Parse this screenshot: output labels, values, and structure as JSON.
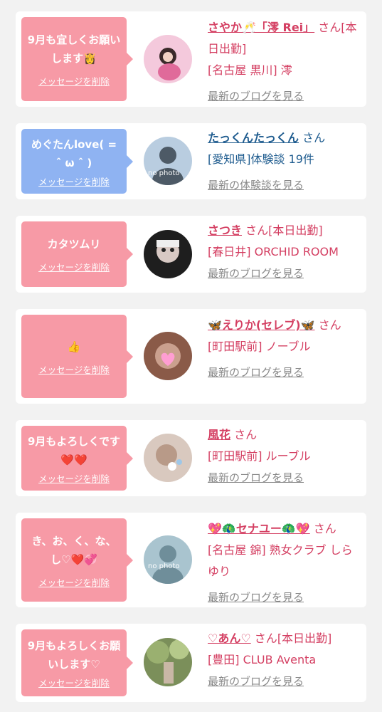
{
  "entries": [
    {
      "message": "9月も宜しくお願いします👸",
      "delete_label": "メッセージを削除",
      "name": "さやか🥂「澪 Rei」",
      "honorific": "さん",
      "detail1": "[本日出勤]",
      "detail2": "[名古屋 黒川] 澪",
      "blog_label": "最新のブログを見る",
      "bubble_color": "#f79aa6",
      "text_color": "#d43f62"
    },
    {
      "message": "めぐたんlove( = ˆ ω ˆ )",
      "delete_label": "メッセージを削除",
      "name": "たっくんたっくん",
      "honorific": "さん",
      "detail1": "[愛知県]体験談 19件",
      "detail2": "",
      "blog_label": "最新の体験談を見る",
      "avatar_text": "no photo",
      "bubble_color": "#8fb3f2",
      "text_color": "#1f5c8f"
    },
    {
      "message": "カタツムリ",
      "delete_label": "メッセージを削除",
      "name": "さつき",
      "honorific": "さん",
      "detail1": "[本日出勤]",
      "detail2": "[春日井] ORCHID ROOM",
      "blog_label": "最新のブログを見る"
    },
    {
      "message": "👍",
      "delete_label": "メッセージを削除",
      "name": "🦋えりか(セレブ)🦋",
      "honorific": "さん",
      "detail1": "",
      "detail2": "[町田駅前] ノーブル",
      "blog_label": "最新のブログを見る"
    },
    {
      "message": "9月もよろしくです❤️❤️",
      "delete_label": "メッセージを削除",
      "name": "風花",
      "honorific": "さん",
      "detail1": "",
      "detail2": "[町田駅前] ルーブル",
      "blog_label": "最新のブログを見る"
    },
    {
      "message": "き、お、く、な、し♡❤️💞",
      "delete_label": "メッセージを削除",
      "name": "💖🦚セナユー🦚💖",
      "honorific": "さん",
      "detail1": "",
      "detail2": "[名古屋 錦] 熟女クラブ しらゆり",
      "blog_label": "最新のブログを見る",
      "avatar_text": "no photo"
    },
    {
      "message": "9月もよろしくお願いします♡",
      "delete_label": "メッセージを削除",
      "name": "♡あん♡",
      "honorific": "さん",
      "detail1": "[本日出勤]",
      "detail2": "[豊田] CLUB Aventa",
      "blog_label": "最新のブログを見る"
    }
  ]
}
